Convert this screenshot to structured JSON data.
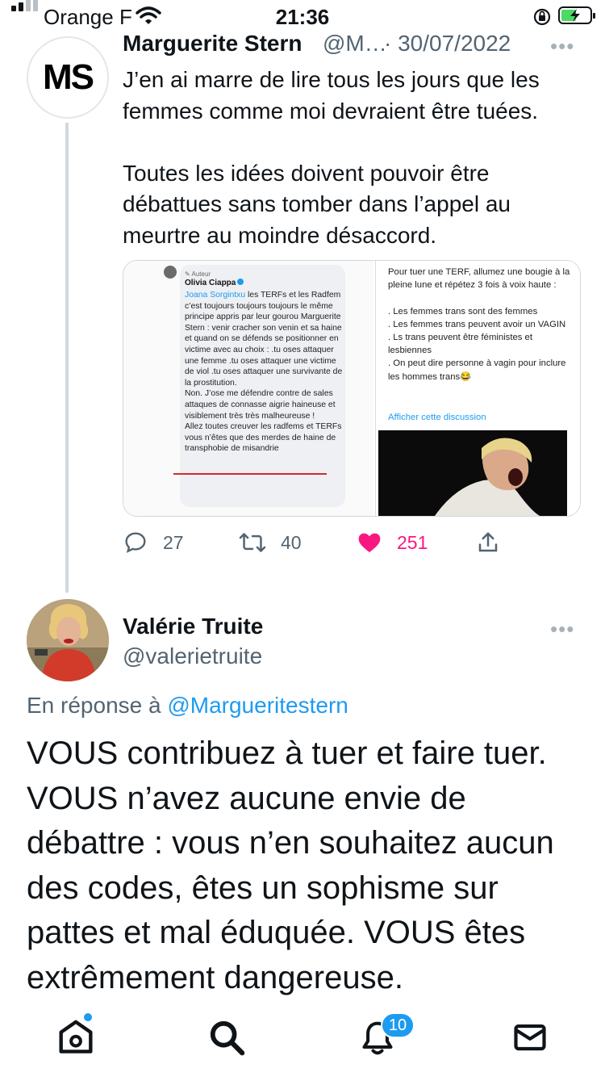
{
  "status_bar": {
    "carrier": "Orange F",
    "time": "21:36"
  },
  "tweet1": {
    "avatar_initials": "MS",
    "author_name": "Marguerite Stern",
    "author_handle": "@M…",
    "date": "· 30/07/2022",
    "more_icon": "more-dots-icon",
    "text": "J’en ai marre de lire tous les jours que les femmes comme moi devraient être tuées.\n\nToutes les idées doivent pouvoir être débattues sans tomber dans l’appel au meurtre au moindre désaccord.",
    "media": {
      "left": {
        "role_label": "Auteur",
        "author": "Olivia Ciappa",
        "mention": "Joana Sorgintxu",
        "body": " les TERFs et les Radfem c’est toujours toujours toujours le même principe appris par leur gourou Marguerite Stern : venir cracher son venin et sa haine et quand on se défends se positionner en victime avec au choix : .tu oses attaquer une femme .tu oses attaquer une victime de viol .tu oses attaquer une survivante de la prostitution.\nNon. J’ose me défendre contre de sales attaques de connasse aigrie haineuse et visiblement très très malheureuse !\nAllez toutes creuver les radfems et TERFs vous n’êtes que des merdes de haine de transphobie de misandrie"
      },
      "right": {
        "text": "Pour tuer une TERF, allumez une bougie à la pleine lune et répétez 3 fois à voix haute :\n\n. Les femmes trans sont des femmes\n. Les femmes trans peuvent avoir un VAGIN\n. Ls trans peuvent être féministes et lesbiennes\n. On peut dire personne à vagin pour inclure les hommes trans😂",
        "link": "Afficher cette discussion"
      }
    },
    "actions": {
      "replies": "27",
      "retweets": "40",
      "likes": "251",
      "like_color": "#f91880"
    }
  },
  "tweet2": {
    "author_name": "Valérie Truite",
    "author_handle": "@valerietruite",
    "more_icon": "more-dots-icon",
    "reply_prefix": "En réponse à ",
    "reply_mention": "@Margueritestern",
    "text": "VOUS contribuez à tuer et faire tuer. VOUS n’avez aucune envie de débattre : vous n’en souhaitez aucun des codes, êtes un sophisme sur pattes et mal éduquée. VOUS êtes extrêmement dangereuse."
  },
  "nav": {
    "items": [
      "home-icon",
      "search-icon",
      "notifications-icon",
      "messages-icon"
    ],
    "notifications_badge": "10"
  },
  "colors": {
    "accent": "#1d9bf0",
    "like": "#f91880",
    "secondary_text": "#536471"
  }
}
